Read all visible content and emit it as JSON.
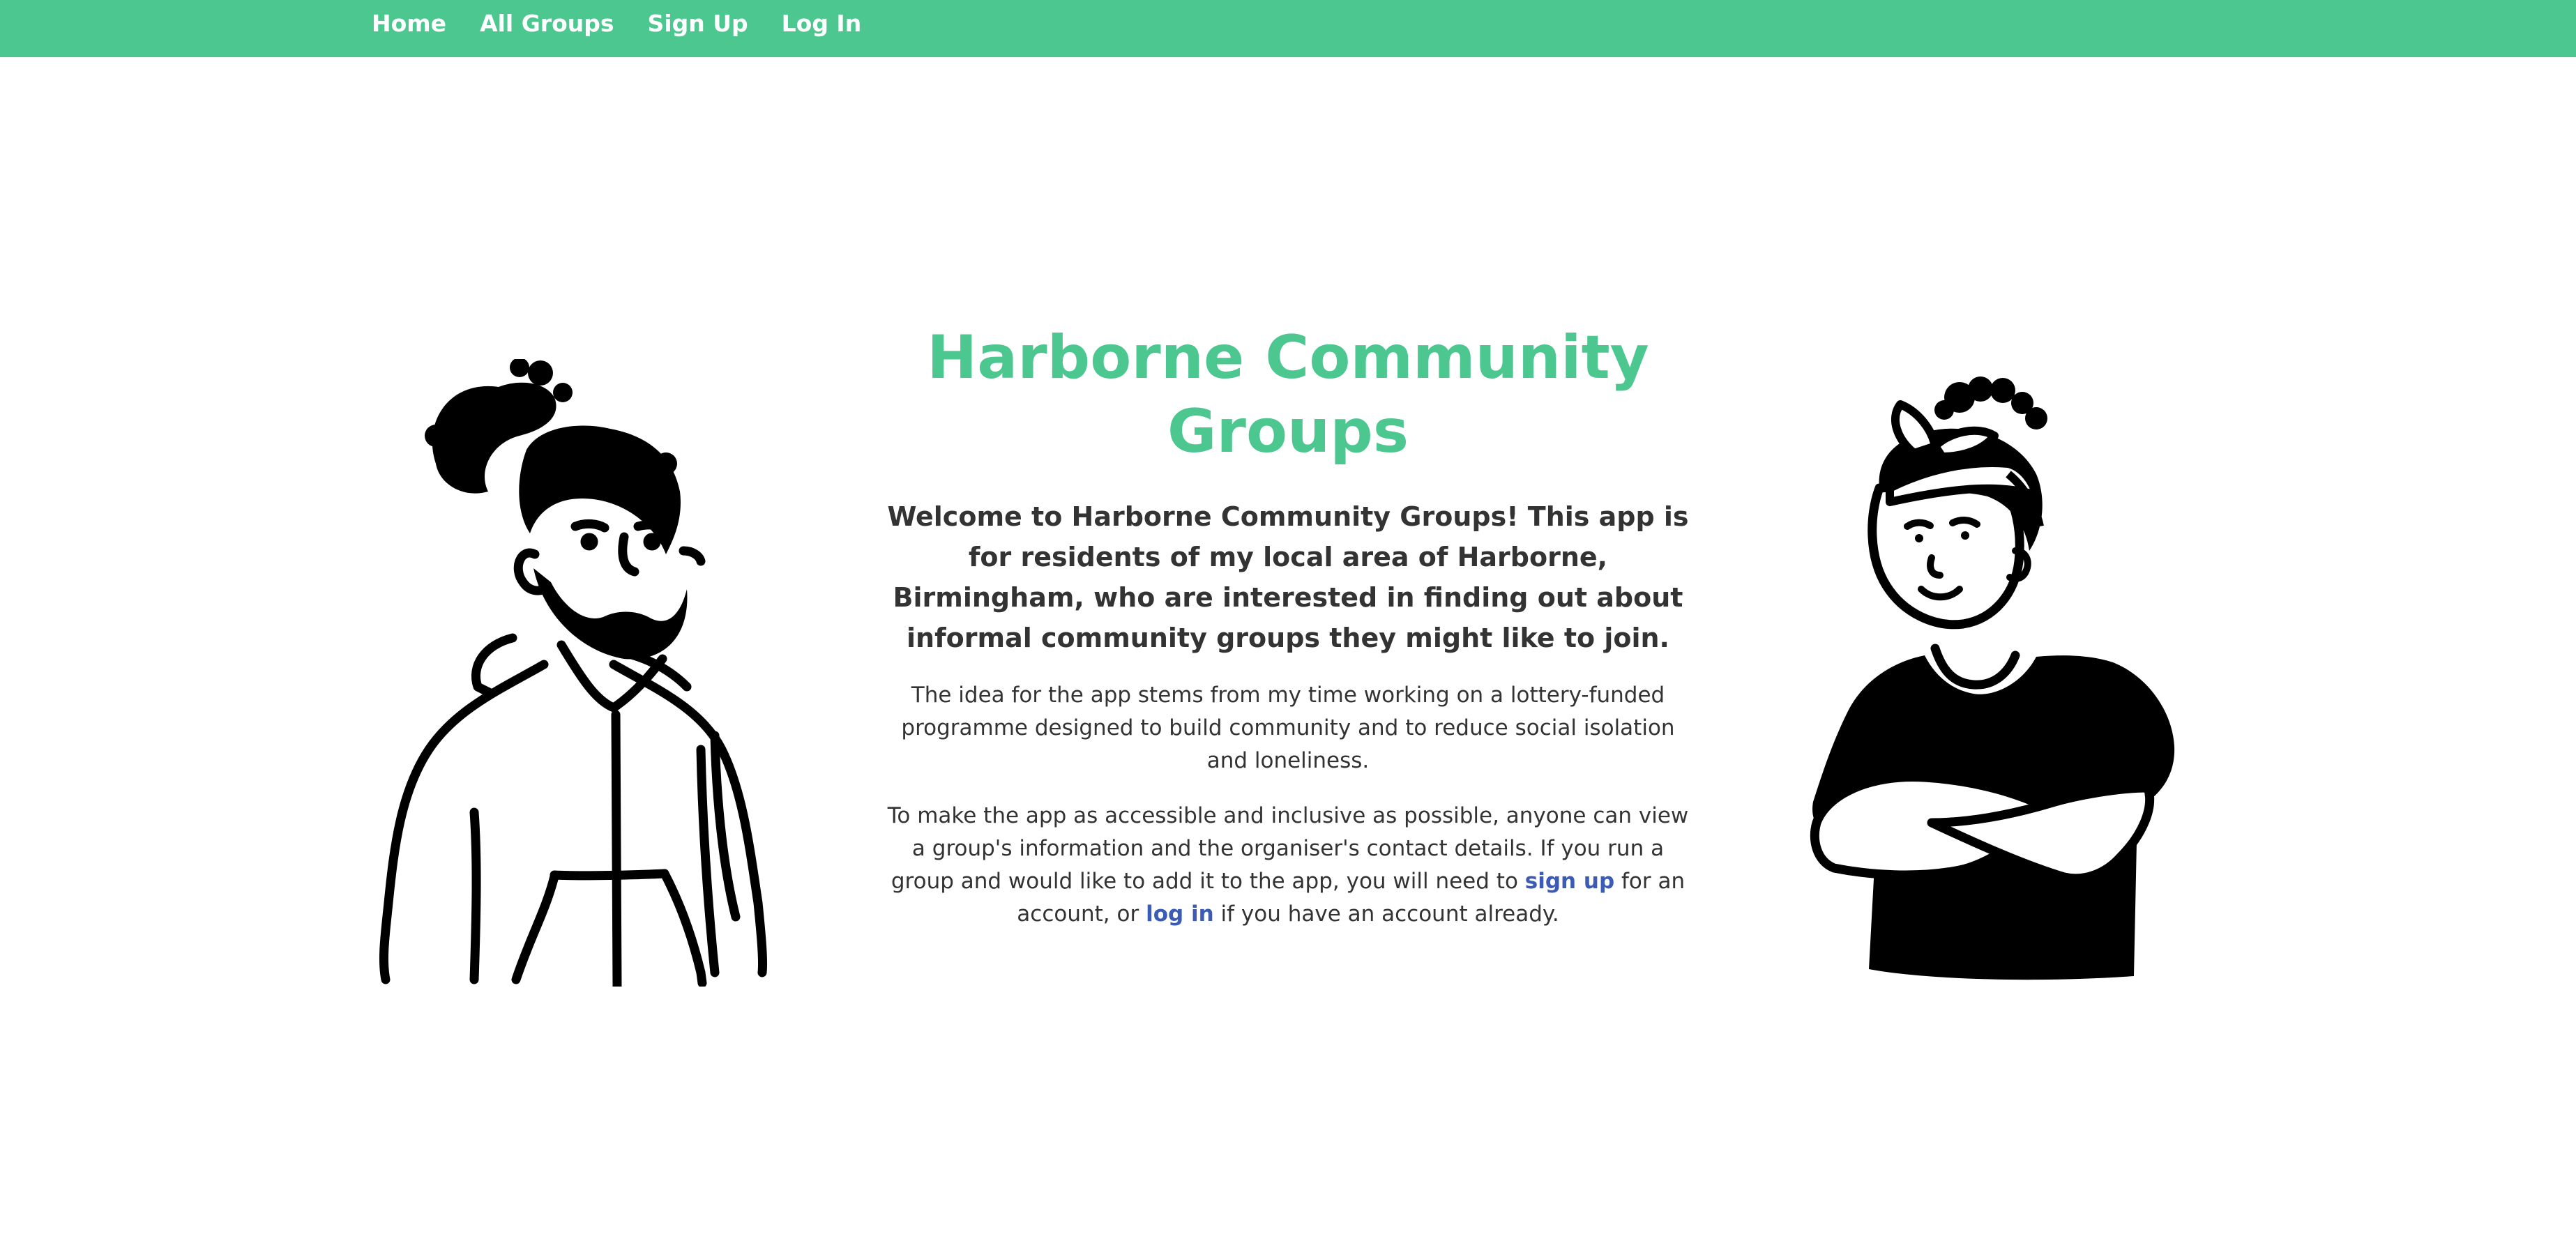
{
  "nav": {
    "home": "Home",
    "all_groups": "All Groups",
    "sign_up": "Sign Up",
    "log_in": "Log In"
  },
  "main": {
    "title": "Harborne Community Groups",
    "lead": "Welcome to Harborne Community Groups! This app is for residents of my local area of Harborne, Birmingham, who are interested in finding out about informal community groups they might like to join.",
    "para1": "The idea for the app stems from my time working on a lottery-funded programme designed to build community and to reduce social isolation and loneliness.",
    "para2_start": "To make the app as accessible and inclusive as possible, anyone can view a group's information and the organiser's contact details. If you run a group and would like to add it to the app, you will need to ",
    "sign_up_link": "sign up",
    "para2_middle": " for an account, or ",
    "log_in_link": "log in",
    "para2_end": " if you have an account already."
  },
  "illustrations": {
    "left": "man-illustration",
    "right": "woman-illustration"
  },
  "colors": {
    "brand_green": "#4bc78f",
    "link_blue": "#3b5bb5",
    "text": "#333333"
  }
}
